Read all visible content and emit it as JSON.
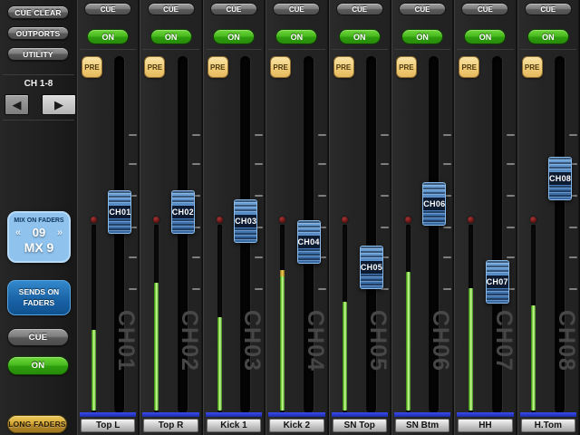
{
  "sidebar": {
    "cue_clear": "CUE CLEAR",
    "outports": "OUTPORTS",
    "utility": "UTILITY",
    "bank_label": "CH 1-8",
    "mix_panel": {
      "title": "MIX ON FADERS",
      "prev": "«",
      "number": "09",
      "next": "»",
      "name": "MX 9"
    },
    "sends_on_faders": "SENDS ON FADERS",
    "cue": "CUE",
    "on": "ON",
    "long_faders": "LONG FADERS"
  },
  "channel_ui": {
    "cue": "CUE",
    "on": "ON",
    "pre": "PRE"
  },
  "channels": [
    {
      "id": "CH01",
      "name": "Top L",
      "fader_pct": 43.7,
      "meter_pct": 43,
      "peak_yellow": false
    },
    {
      "id": "CH02",
      "name": "Top R",
      "fader_pct": 43.7,
      "meter_pct": 68,
      "peak_yellow": false
    },
    {
      "id": "CH03",
      "name": "Kick 1",
      "fader_pct": 46.2,
      "meter_pct": 50,
      "peak_yellow": false
    },
    {
      "id": "CH04",
      "name": "Kick 2",
      "fader_pct": 52.0,
      "meter_pct": 75,
      "peak_yellow": true
    },
    {
      "id": "CH05",
      "name": "SN Top",
      "fader_pct": 59.1,
      "meter_pct": 58,
      "peak_yellow": false
    },
    {
      "id": "CH06",
      "name": "SN Btm",
      "fader_pct": 41.4,
      "meter_pct": 74,
      "peak_yellow": false
    },
    {
      "id": "CH07",
      "name": "HH",
      "fader_pct": 63.2,
      "meter_pct": 65,
      "peak_yellow": false
    },
    {
      "id": "CH08",
      "name": "H.Tom",
      "fader_pct": 34.3,
      "meter_pct": 56,
      "peak_yellow": false
    }
  ],
  "colors": {
    "accent_blue": "#8fc3ee",
    "sends_blue": "#1a63a6",
    "on_green": "#2f9e0e",
    "pre_tan": "#efca74",
    "long_faders_gold": "#d6a936",
    "meter_green": "#a4f45e",
    "channel_bar_blue": "#2c3cd4",
    "fader_cap_blue": "#4d82c0"
  }
}
